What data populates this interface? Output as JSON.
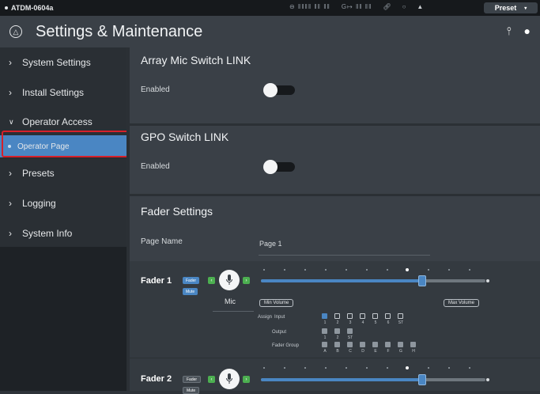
{
  "topbar": {
    "device": "ATDM-0604a",
    "preset": "Preset",
    "status_input": "⊖ ‖‖‖‖ ‖‖ ‖‖",
    "status_output": "G↦ ‖‖ ‖‖"
  },
  "header": {
    "title": "Settings & Maintenance"
  },
  "sidebar": {
    "items": [
      {
        "label": "System Settings"
      },
      {
        "label": "Install Settings"
      },
      {
        "label": "Operator Access"
      },
      {
        "label": "Operator Page"
      },
      {
        "label": "Presets"
      },
      {
        "label": "Logging"
      },
      {
        "label": "System Info"
      }
    ]
  },
  "array_mic": {
    "title": "Array Mic Switch LINK",
    "enabled_label": "Enabled",
    "enabled": false
  },
  "gpo": {
    "title": "GPO Switch LINK",
    "enabled_label": "Enabled",
    "enabled": false
  },
  "fader_settings": {
    "title": "Fader Settings",
    "page_name_label": "Page Name",
    "page_name_value": "Page 1"
  },
  "fader1": {
    "name": "Fader 1",
    "fader_chip": "Fader",
    "mute_chip": "Mute",
    "mic_label": "Mic",
    "min_volume": "Min Volume",
    "max_volume": "Max Volume",
    "level": 0.72,
    "assign_label": "Assign",
    "input_label": "Input",
    "output_label": "Output",
    "group_label": "Fader Group",
    "inputs": [
      "1",
      "2",
      "3",
      "4",
      "5",
      "6",
      "ST"
    ],
    "outputs": [
      "1",
      "2",
      "ST"
    ],
    "groups": [
      "A",
      "B",
      "C",
      "D",
      "E",
      "F",
      "G",
      "H"
    ]
  },
  "fader2": {
    "name": "Fader 2",
    "fader_chip": "Fader",
    "mute_chip": "Mute",
    "level": 0.72
  },
  "colors": {
    "accent": "#4a86c3",
    "highlight": "#d6202a",
    "green": "#4caf50"
  }
}
